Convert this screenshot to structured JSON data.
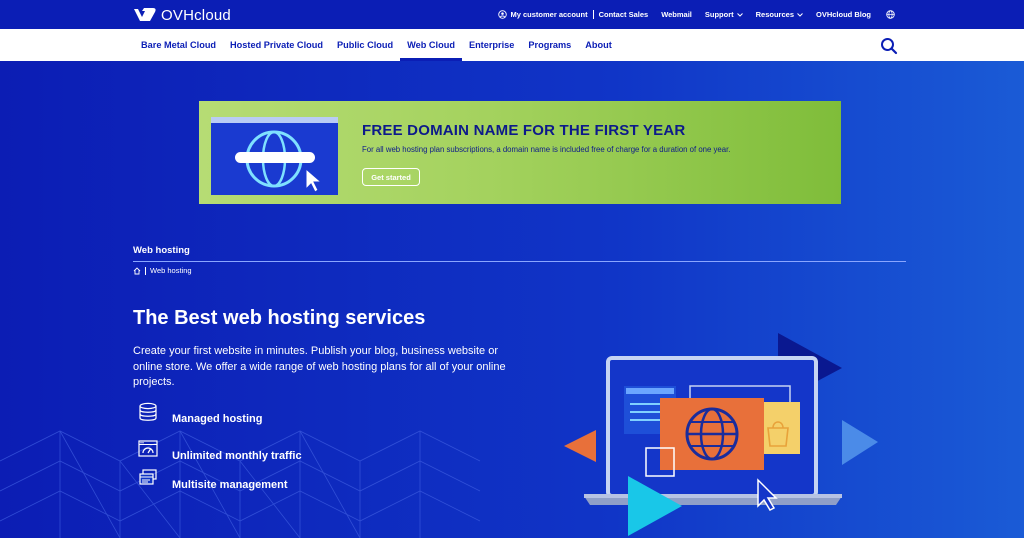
{
  "brand": {
    "name": "OVHcloud"
  },
  "topbar": {
    "links": [
      {
        "label": "My customer account",
        "icon": "user-circle-icon"
      },
      {
        "label": "Contact Sales"
      },
      {
        "label": "Webmail"
      },
      {
        "label": "Support",
        "dropdown": true
      },
      {
        "label": "Resources",
        "dropdown": true
      },
      {
        "label": "OVHcloud Blog"
      }
    ],
    "globe_icon": "globe-icon"
  },
  "nav": {
    "items": [
      {
        "label": "Bare Metal Cloud"
      },
      {
        "label": "Hosted Private Cloud"
      },
      {
        "label": "Public Cloud"
      },
      {
        "label": "Web Cloud",
        "active": true
      },
      {
        "label": "Enterprise"
      },
      {
        "label": "Programs"
      },
      {
        "label": "About"
      }
    ],
    "search_icon": "search-icon"
  },
  "banner": {
    "title": "FREE DOMAIN NAME FOR THE FIRST YEAR",
    "description": "For all web hosting plan subscriptions, a domain name is included free of charge for a duration of one year.",
    "button_label": "Get started"
  },
  "section": {
    "title": "Web hosting",
    "breadcrumb": [
      "Web hosting"
    ]
  },
  "hero": {
    "title": "The Best web hosting services",
    "description": "Create your first website in minutes. Publish your blog, business website or online store. We offer a wide range of web hosting plans for all of your online projects.",
    "features": [
      {
        "label": "Managed hosting",
        "icon": "database-icon"
      },
      {
        "label": "Unlimited monthly traffic",
        "icon": "browser-traffic-icon"
      },
      {
        "label": "Multisite management",
        "icon": "multi-window-icon"
      }
    ]
  },
  "colors": {
    "brand_blue": "#0b1eb5",
    "banner_green": "#a4d25e",
    "banner_text": "#0d1a8a",
    "accent_orange": "#e8703a",
    "accent_cyan": "#19c7e8"
  }
}
